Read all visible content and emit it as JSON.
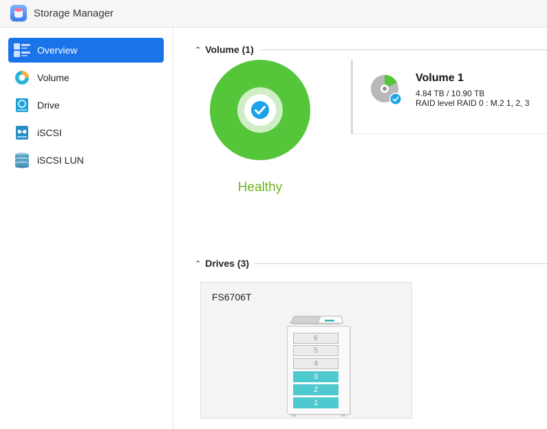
{
  "window": {
    "title": "Storage Manager"
  },
  "sidebar": {
    "items": [
      {
        "label": "Overview",
        "icon": "overview-icon",
        "active": true
      },
      {
        "label": "Volume",
        "icon": "volume-icon",
        "active": false
      },
      {
        "label": "Drive",
        "icon": "drive-icon",
        "active": false
      },
      {
        "label": "iSCSI",
        "icon": "iscsi-icon",
        "active": false
      },
      {
        "label": "iSCSI LUN",
        "icon": "iscsi-lun-icon",
        "active": false
      }
    ]
  },
  "volume_section": {
    "title": "Volume (1)",
    "status": "Healthy",
    "volume": {
      "name": "Volume 1",
      "usage": "4.84 TB / 10.90 TB",
      "raid": "RAID level RAID 0 : M.2 1, 2, 3"
    }
  },
  "drives_section": {
    "title": "Drives (3)",
    "model": "FS6706T",
    "bays": [
      {
        "label": "6",
        "filled": false
      },
      {
        "label": "5",
        "filled": false
      },
      {
        "label": "4",
        "filled": false
      },
      {
        "label": "3",
        "filled": true
      },
      {
        "label": "2",
        "filled": true
      },
      {
        "label": "1",
        "filled": true
      }
    ]
  },
  "colors": {
    "accent": "#1a73e8",
    "healthy_green": "#55c63a",
    "healthy_text": "#6cb21e",
    "check_blue": "#1aa3e8",
    "bay_filled": "#4ec9cf"
  }
}
